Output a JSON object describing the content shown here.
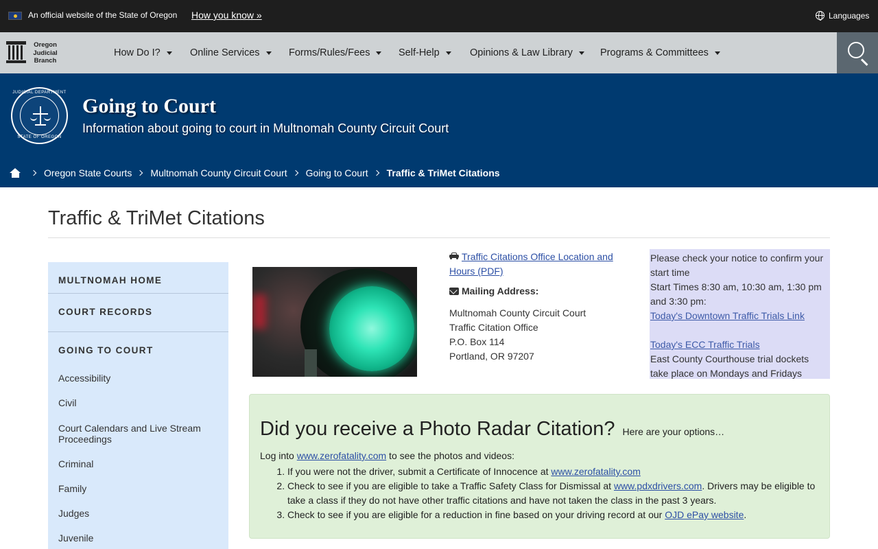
{
  "topbar": {
    "official_text": "An official website of the State of Oregon",
    "how_you_know": "How you know »",
    "languages": "Languages",
    "flag_icon": "oregon-flag-icon",
    "globe_icon": "globe-icon"
  },
  "nav": {
    "logo_lines": [
      "Oregon",
      "Judicial",
      "Branch"
    ],
    "items": [
      "How Do I?",
      "Online Services",
      "Forms/Rules/Fees",
      "Self-Help",
      "Opinions & Law Library",
      "Programs & Committees"
    ],
    "search_icon": "search-icon"
  },
  "banner": {
    "title": "Going to Court",
    "subtitle": "Information about going to court in Multnomah County Circuit Court",
    "seal_top": "JUDICIAL DEPARTMENT",
    "seal_bottom": "STATE OF OREGON"
  },
  "breadcrumb": {
    "items": [
      "Oregon State Courts",
      "Multnomah County Circuit Court",
      "Going to Court"
    ],
    "current": "Traffic & TriMet Citations"
  },
  "page": {
    "title": "Traffic & TriMet Citations"
  },
  "sidebar": {
    "head1": "MULTNOMAH HOME",
    "head2": "COURT RECORDS",
    "head3": "GOING TO COURT",
    "links": [
      "Accessibility",
      "Civil",
      "Court Calendars and Live Stream Proceedings",
      "Criminal",
      "Family",
      "Judges",
      "Juvenile"
    ]
  },
  "location": {
    "link": "Traffic Citations Office Location and Hours (PDF)",
    "mailing_head": "Mailing Address:",
    "address": [
      "Multnomah County Circuit Court",
      "Traffic Citation Office",
      "P.O. Box 114",
      "Portland, OR 97207"
    ]
  },
  "notice": {
    "line1": "Please check your notice to confirm your start time",
    "line2": "Start Times 8:30 am, 10:30 am, 1:30 pm and 3:30 pm:",
    "link1": "Today's Downtown Traffic Trials Link",
    "link2": "Today's ECC Traffic Trials",
    "line3": "East County Courthouse trial dockets take place on Mondays and Fridays"
  },
  "radar": {
    "heading": "Did you receive a Photo Radar Citation?",
    "heading_small": "Here are your options…",
    "intro_pre": "Log into ",
    "intro_link": "www.zerofatality.com",
    "intro_post": " to see the photos and videos:",
    "item1_pre": "If you were not the driver, submit a Certificate of Innocence at ",
    "item1_link": "www.zerofatality.com",
    "item2_pre": "Check to see if you are eligible to take a Traffic Safety Class for Dismissal at ",
    "item2_link": "www.pdxdrivers.com",
    "item2_post": ". Drivers may be eligible to take a class if they do not have other traffic citations and have not taken the class in the past 3 years.",
    "item3_pre": "Check to see if you are eligible for a reduction in fine based on your driving record at our ",
    "item3_link": "OJD ePay website",
    "item3_post": "."
  }
}
